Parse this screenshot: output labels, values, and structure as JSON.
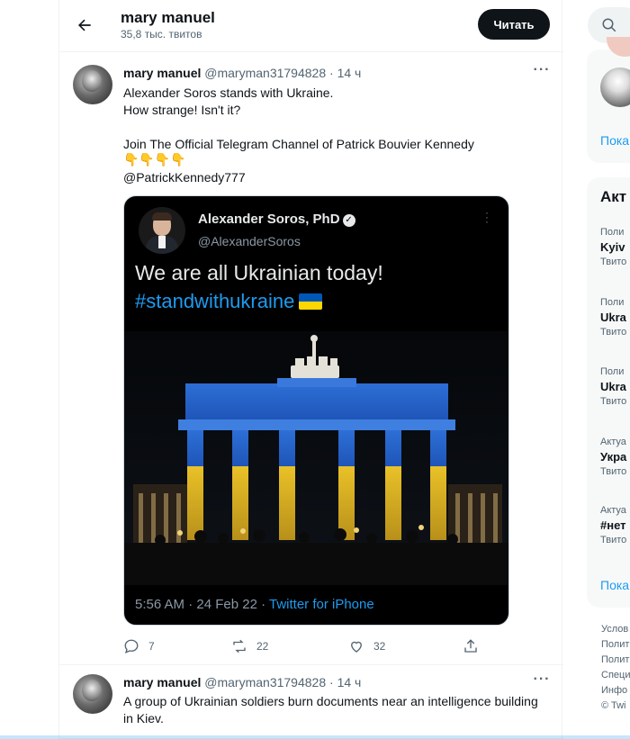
{
  "header": {
    "profile_name": "mary manuel",
    "tweet_count": "35,8 тыс. твитов",
    "follow_label": "Читать"
  },
  "tweets": [
    {
      "name": "mary manuel",
      "handle": "@maryman31794828",
      "dot": "·",
      "time": "14 ч",
      "text": "Alexander Soros stands with Ukraine.\nHow strange! Isn't it?\n\nJoin The Official Telegram Channel of Patrick Bouvier Kennedy",
      "emojis": "👇👇👇👇",
      "mention": "@PatrickKennedy777",
      "embedded": {
        "name": "Alexander Soros, PhD",
        "handle": "@AlexanderSoros",
        "line1": "We are all Ukrainian today!",
        "hashtag": "#standwithukraine",
        "timestamp": "5:56 AM · 24 Feb 22 · ",
        "source": "Twitter for iPhone"
      },
      "actions": {
        "replies": "7",
        "retweets": "22",
        "likes": "32"
      }
    },
    {
      "name": "mary manuel",
      "handle": "@maryman31794828",
      "dot": "·",
      "time": "14 ч",
      "text": "A group of Ukrainian soldiers burn documents near an intelligence building\nin Kiev."
    }
  ],
  "sidebar": {
    "who_to_follow_link": "Пока",
    "trends_title": "Акт",
    "trends": [
      {
        "category": "Поли",
        "topic": "Kyiv",
        "count": "Твито"
      },
      {
        "category": "Поли",
        "topic": "Ukra",
        "count": "Твито"
      },
      {
        "category": "Поли",
        "topic": "Ukra",
        "count": "Твито"
      },
      {
        "category": "Актуа",
        "topic": "Укра",
        "count": "Твито"
      },
      {
        "category": "Актуа",
        "topic": "#нет",
        "count": "Твито"
      }
    ],
    "trends_link": "Пока",
    "footer": [
      "Услов",
      "Полит",
      "Полит",
      "Специ",
      "Инфо",
      "© Twi"
    ]
  },
  "colors": {
    "accent": "#1d9bf0",
    "text": "#0f1419",
    "muted": "#536471",
    "ukraine_blue": "#0057b7",
    "ukraine_yellow": "#ffd700"
  },
  "icons": [
    "back-arrow-icon",
    "more-icon",
    "verified-icon",
    "reply-icon",
    "retweet-icon",
    "like-icon",
    "share-icon",
    "search-icon"
  ]
}
